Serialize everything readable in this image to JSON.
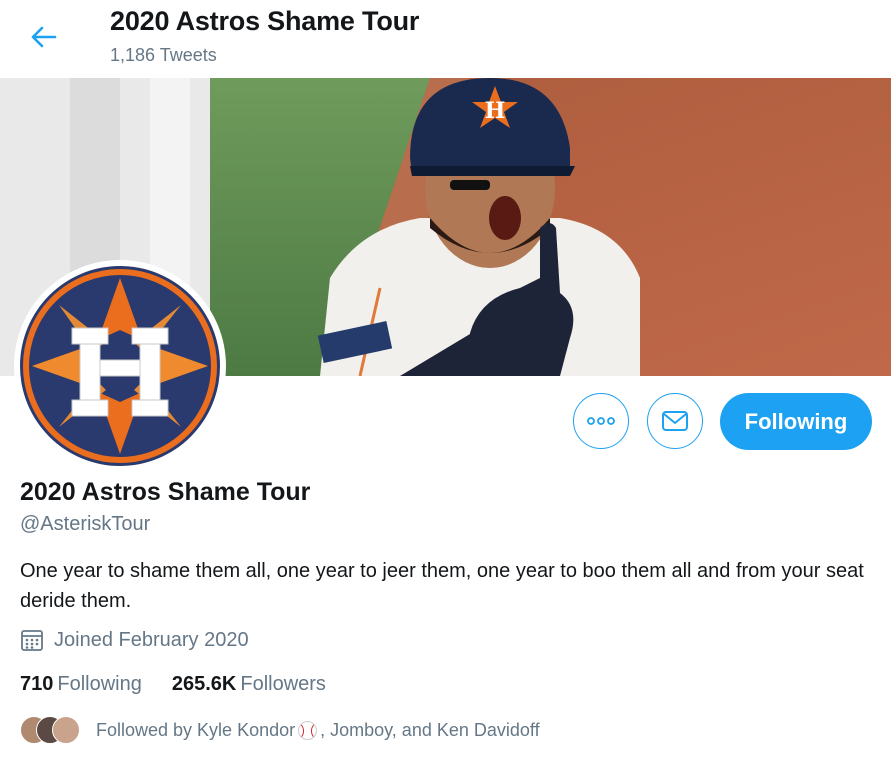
{
  "header": {
    "title": "2020 Astros Shame Tour",
    "tweets_count": "1,186 Tweets"
  },
  "banner": {
    "icon": "banner-photo"
  },
  "actions": {
    "more_icon": "more-icon",
    "message_icon": "mail-icon",
    "follow_label": "Following"
  },
  "profile": {
    "name": "2020 Astros Shame Tour",
    "handle": "@AsteriskTour",
    "bio": "One year to shame them all, one year to jeer them, one year to boo them all and from your seat deride them.",
    "joined": "Joined February 2020"
  },
  "stats": {
    "following_count": "710",
    "following_label": "Following",
    "followers_count": "265.6K",
    "followers_label": "Followers"
  },
  "followed_by": {
    "prefix": "Followed by Kyle Kondor",
    "suffix": ", Jomboy, and Ken Davidoff"
  },
  "colors": {
    "accent": "#1da1f2",
    "astros_navy": "#002d62",
    "astros_orange": "#eb6e1f"
  }
}
